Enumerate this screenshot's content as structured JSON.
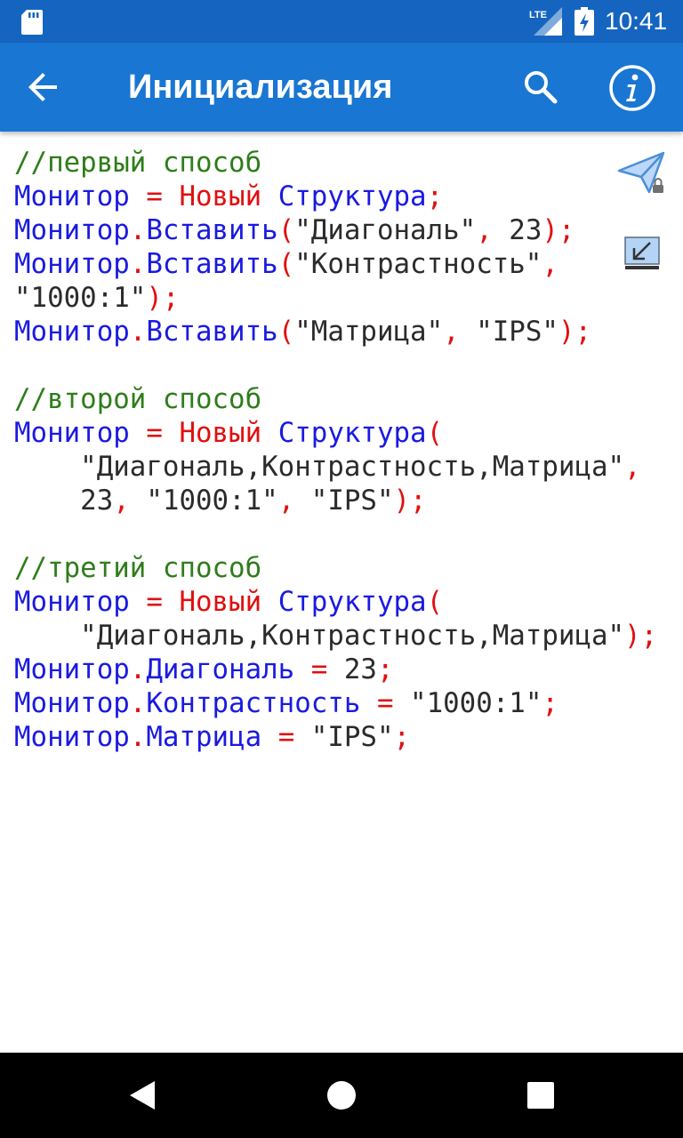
{
  "status_bar": {
    "time": "10:41",
    "network": "LTE",
    "icons": [
      "sd-card-icon",
      "lte-signal-icon",
      "battery-charging-icon"
    ]
  },
  "app_bar": {
    "title": "Инициализация",
    "icons": [
      "back-arrow-icon",
      "search-icon",
      "info-icon"
    ]
  },
  "colors": {
    "status_bar": "#1565c0",
    "app_bar": "#1976d2",
    "keyword": "#1a1ae0",
    "constructor": "#e01010",
    "comment": "#2e7d1a",
    "string": "#2b2b2b"
  },
  "side_icons": [
    "send-icon",
    "collapse-icon"
  ],
  "code": {
    "lines": [
      [
        {
          "t": "//первый способ",
          "c": "cm"
        }
      ],
      [
        {
          "t": "Монитор",
          "c": "kw"
        },
        {
          "t": " ",
          "c": "str"
        },
        {
          "t": "=",
          "c": "op"
        },
        {
          "t": " ",
          "c": "str"
        },
        {
          "t": "Новый",
          "c": "ctor"
        },
        {
          "t": " ",
          "c": "str"
        },
        {
          "t": "Структура",
          "c": "kw"
        },
        {
          "t": ";",
          "c": "op"
        }
      ],
      [
        {
          "t": "Монитор",
          "c": "kw"
        },
        {
          "t": ".",
          "c": "op"
        },
        {
          "t": "Вставить",
          "c": "kw"
        },
        {
          "t": "(",
          "c": "op"
        },
        {
          "t": "\"Диагональ\"",
          "c": "str"
        },
        {
          "t": ",",
          "c": "op"
        },
        {
          "t": " ",
          "c": "str"
        },
        {
          "t": "23",
          "c": "num"
        },
        {
          "t": ");",
          "c": "op"
        }
      ],
      [
        {
          "t": "Монитор",
          "c": "kw"
        },
        {
          "t": ".",
          "c": "op"
        },
        {
          "t": "Вставить",
          "c": "kw"
        },
        {
          "t": "(",
          "c": "op"
        },
        {
          "t": "\"Контрастность\"",
          "c": "str"
        },
        {
          "t": ",",
          "c": "op"
        }
      ],
      [
        {
          "t": "\"1000:1\"",
          "c": "str"
        },
        {
          "t": ");",
          "c": "op"
        }
      ],
      [
        {
          "t": "Монитор",
          "c": "kw"
        },
        {
          "t": ".",
          "c": "op"
        },
        {
          "t": "Вставить",
          "c": "kw"
        },
        {
          "t": "(",
          "c": "op"
        },
        {
          "t": "\"Матрица\"",
          "c": "str"
        },
        {
          "t": ",",
          "c": "op"
        },
        {
          "t": " ",
          "c": "str"
        },
        {
          "t": "\"IPS\"",
          "c": "str"
        },
        {
          "t": ");",
          "c": "op"
        }
      ],
      [],
      [
        {
          "t": "//второй способ",
          "c": "cm"
        }
      ],
      [
        {
          "t": "Монитор",
          "c": "kw"
        },
        {
          "t": " ",
          "c": "str"
        },
        {
          "t": "=",
          "c": "op"
        },
        {
          "t": " ",
          "c": "str"
        },
        {
          "t": "Новый",
          "c": "ctor"
        },
        {
          "t": " ",
          "c": "str"
        },
        {
          "t": "Структура",
          "c": "kw"
        },
        {
          "t": "(",
          "c": "op"
        }
      ],
      [
        {
          "t": "    ",
          "c": "str"
        },
        {
          "t": "\"Диагональ,Контрастность,Матрица\"",
          "c": "str"
        },
        {
          "t": ",",
          "c": "op"
        }
      ],
      [
        {
          "t": "    ",
          "c": "str"
        },
        {
          "t": "23",
          "c": "num"
        },
        {
          "t": ",",
          "c": "op"
        },
        {
          "t": " ",
          "c": "str"
        },
        {
          "t": "\"1000:1\"",
          "c": "str"
        },
        {
          "t": ",",
          "c": "op"
        },
        {
          "t": " ",
          "c": "str"
        },
        {
          "t": "\"IPS\"",
          "c": "str"
        },
        {
          "t": ");",
          "c": "op"
        }
      ],
      [],
      [
        {
          "t": "//третий способ",
          "c": "cm"
        }
      ],
      [
        {
          "t": "Монитор",
          "c": "kw"
        },
        {
          "t": " ",
          "c": "str"
        },
        {
          "t": "=",
          "c": "op"
        },
        {
          "t": " ",
          "c": "str"
        },
        {
          "t": "Новый",
          "c": "ctor"
        },
        {
          "t": " ",
          "c": "str"
        },
        {
          "t": "Структура",
          "c": "kw"
        },
        {
          "t": "(",
          "c": "op"
        }
      ],
      [
        {
          "t": "    ",
          "c": "str"
        },
        {
          "t": "\"Диагональ,Контрастность,Матрица\"",
          "c": "str"
        },
        {
          "t": ");",
          "c": "op"
        }
      ],
      [
        {
          "t": "Монитор",
          "c": "kw"
        },
        {
          "t": ".",
          "c": "op"
        },
        {
          "t": "Диагональ",
          "c": "kw"
        },
        {
          "t": " ",
          "c": "str"
        },
        {
          "t": "=",
          "c": "op"
        },
        {
          "t": " ",
          "c": "str"
        },
        {
          "t": "23",
          "c": "num"
        },
        {
          "t": ";",
          "c": "op"
        }
      ],
      [
        {
          "t": "Монитор",
          "c": "kw"
        },
        {
          "t": ".",
          "c": "op"
        },
        {
          "t": "Контрастность",
          "c": "kw"
        },
        {
          "t": " ",
          "c": "str"
        },
        {
          "t": "=",
          "c": "op"
        },
        {
          "t": " ",
          "c": "str"
        },
        {
          "t": "\"1000:1\"",
          "c": "str"
        },
        {
          "t": ";",
          "c": "op"
        }
      ],
      [
        {
          "t": "Монитор",
          "c": "kw"
        },
        {
          "t": ".",
          "c": "op"
        },
        {
          "t": "Матрица",
          "c": "kw"
        },
        {
          "t": " ",
          "c": "str"
        },
        {
          "t": "=",
          "c": "op"
        },
        {
          "t": " ",
          "c": "str"
        },
        {
          "t": "\"IPS\"",
          "c": "str"
        },
        {
          "t": ";",
          "c": "op"
        }
      ]
    ]
  },
  "nav_bar": {
    "icons": [
      "nav-back-icon",
      "nav-home-icon",
      "nav-recents-icon"
    ]
  }
}
